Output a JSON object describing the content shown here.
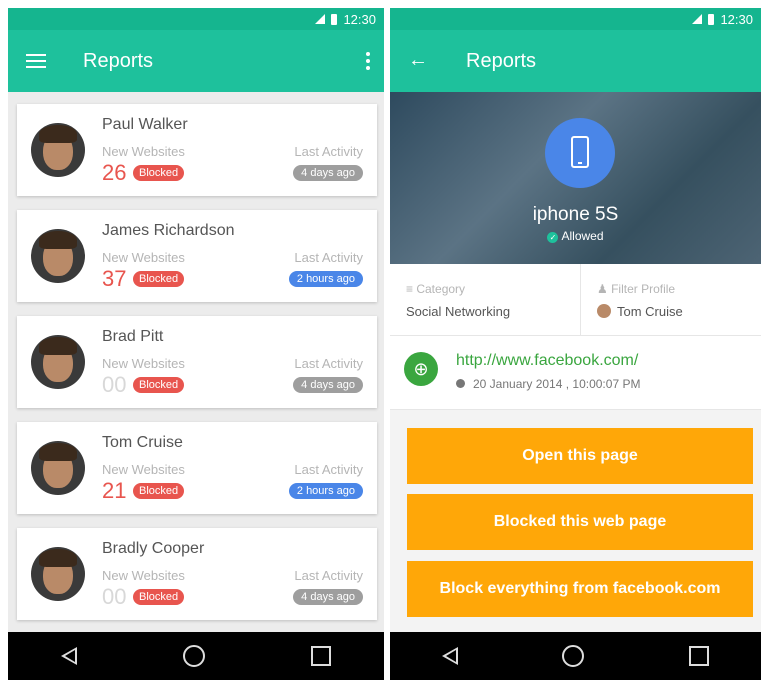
{
  "status_bar": {
    "time": "12:30"
  },
  "colors": {
    "accent": "#1ec19c",
    "danger": "#e8554e",
    "info": "#4a86e8",
    "muted": "#9e9e9e",
    "action": "#ffa708",
    "link": "#3aa63f"
  },
  "left": {
    "title": "Reports",
    "cards": [
      {
        "name": "Paul Walker",
        "new_label": "New Websites",
        "count": "26",
        "blocked": "Blocked",
        "last_label": "Last Activity",
        "time": "4 days ago"
      },
      {
        "name": "James Richardson",
        "new_label": "New Websites",
        "count": "37",
        "blocked": "Blocked",
        "last_label": "Last Activity",
        "time": "2 hours ago"
      },
      {
        "name": "Brad Pitt",
        "new_label": "New Websites",
        "count": "00",
        "blocked": "Blocked",
        "last_label": "Last Activity",
        "time": "4 days ago"
      },
      {
        "name": "Tom Cruise",
        "new_label": "New Websites",
        "count": "21",
        "blocked": "Blocked",
        "last_label": "Last Activity",
        "time": "2 hours ago"
      },
      {
        "name": "Bradly Cooper",
        "new_label": "New Websites",
        "count": "00",
        "blocked": "Blocked",
        "last_label": "Last Activity",
        "time": "4 days ago"
      }
    ]
  },
  "right": {
    "title": "Reports",
    "device": {
      "name": "iphone 5S",
      "status": "Allowed"
    },
    "category_label": "Category",
    "category_value": "Social Networking",
    "filter_label": "Filter Profile",
    "filter_value": "Tom Cruise",
    "url": "http://www.facebook.com/",
    "timestamp": "20 January 2014 , 10:00:07 PM",
    "buttons": [
      "Open this page",
      "Blocked this web page",
      "Block everything from facebook.com"
    ]
  }
}
